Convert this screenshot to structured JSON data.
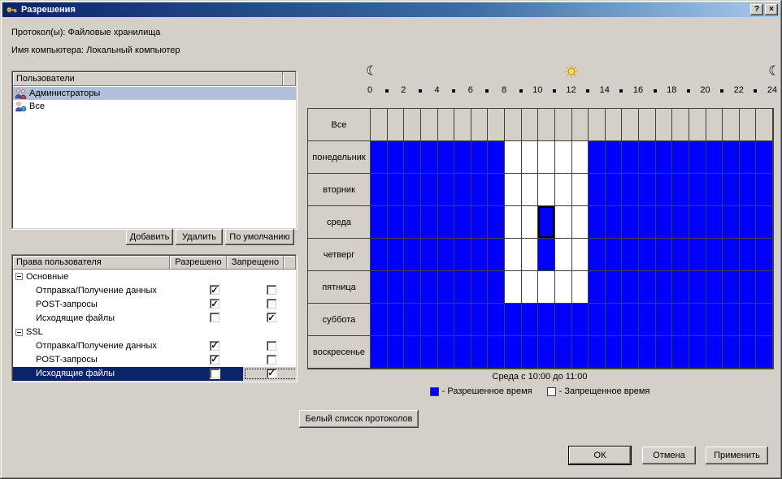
{
  "window": {
    "title": "Разрешения",
    "help_button": "?",
    "close_button": "×"
  },
  "header": {
    "protocols_label": "Протокол(ы): Файловые хранилища",
    "computer_label": "Имя компьютера: Локальный компьютер"
  },
  "users": {
    "header": "Пользователи",
    "items": [
      {
        "name": "Администраторы",
        "icon": "users-group-icon",
        "selected": true
      },
      {
        "name": "Все",
        "icon": "user-globe-icon",
        "selected": false
      }
    ],
    "buttons": {
      "add": "Добавить",
      "remove": "Удалить",
      "default": "По умолчанию"
    }
  },
  "rights": {
    "columns": [
      "Права пользователя",
      "Разрешено",
      "Запрещено"
    ],
    "rows": [
      {
        "type": "group",
        "label": "Основные"
      },
      {
        "type": "item",
        "label": "Отправка/Получение данных",
        "allowed": true,
        "denied": false
      },
      {
        "type": "item",
        "label": "POST-запросы",
        "allowed": true,
        "denied": false
      },
      {
        "type": "item",
        "label": "Исходящие файлы",
        "allowed": false,
        "denied": true
      },
      {
        "type": "group",
        "label": "SSL"
      },
      {
        "type": "item",
        "label": "Отправка/Получение данных",
        "allowed": true,
        "denied": false
      },
      {
        "type": "item",
        "label": "POST-запросы",
        "allowed": true,
        "denied": false
      },
      {
        "type": "item",
        "label": "Исходящие файлы",
        "allowed": false,
        "denied": true,
        "selected": true
      }
    ]
  },
  "whitelist_button": "Белый список протоколов",
  "schedule": {
    "hour_labels": [
      "0",
      "2",
      "4",
      "6",
      "8",
      "10",
      "12",
      "14",
      "16",
      "18",
      "20",
      "22",
      "24"
    ],
    "icons": {
      "left": "moon-icon",
      "middle": "sun-icon",
      "right": "moon-icon"
    },
    "rows": [
      {
        "label": "Все",
        "type": "all"
      },
      {
        "label": "понедельник",
        "type": "day",
        "cells": [
          1,
          1,
          1,
          1,
          1,
          1,
          1,
          1,
          0,
          0,
          0,
          0,
          0,
          1,
          1,
          1,
          1,
          1,
          1,
          1,
          1,
          1,
          1,
          1
        ]
      },
      {
        "label": "вторник",
        "type": "day",
        "cells": [
          1,
          1,
          1,
          1,
          1,
          1,
          1,
          1,
          0,
          0,
          0,
          0,
          0,
          1,
          1,
          1,
          1,
          1,
          1,
          1,
          1,
          1,
          1,
          1
        ]
      },
      {
        "label": "среда",
        "type": "day",
        "cells": [
          1,
          1,
          1,
          1,
          1,
          1,
          1,
          1,
          0,
          0,
          1,
          0,
          0,
          1,
          1,
          1,
          1,
          1,
          1,
          1,
          1,
          1,
          1,
          1
        ]
      },
      {
        "label": "четверг",
        "type": "day",
        "cells": [
          1,
          1,
          1,
          1,
          1,
          1,
          1,
          1,
          0,
          0,
          1,
          0,
          0,
          1,
          1,
          1,
          1,
          1,
          1,
          1,
          1,
          1,
          1,
          1
        ]
      },
      {
        "label": "пятница",
        "type": "day",
        "cells": [
          1,
          1,
          1,
          1,
          1,
          1,
          1,
          1,
          0,
          0,
          0,
          0,
          0,
          1,
          1,
          1,
          1,
          1,
          1,
          1,
          1,
          1,
          1,
          1
        ]
      },
      {
        "label": "суббота",
        "type": "day",
        "cells": [
          1,
          1,
          1,
          1,
          1,
          1,
          1,
          1,
          1,
          1,
          1,
          1,
          1,
          1,
          1,
          1,
          1,
          1,
          1,
          1,
          1,
          1,
          1,
          1
        ]
      },
      {
        "label": "воскресенье",
        "type": "day",
        "cells": [
          1,
          1,
          1,
          1,
          1,
          1,
          1,
          1,
          1,
          1,
          1,
          1,
          1,
          1,
          1,
          1,
          1,
          1,
          1,
          1,
          1,
          1,
          1,
          1
        ]
      }
    ],
    "selected_cell": {
      "row": "среда",
      "hour": 10
    },
    "selection_text": "Среда с 10:00 до 11:00",
    "legend": [
      {
        "color": "#0000ff",
        "label": "- Разрешенное время"
      },
      {
        "color": "#ffffff",
        "label": "- Запрещенное время"
      }
    ],
    "colors": {
      "allowed": "#0000ff",
      "denied": "#ffffff",
      "selection_border": "#000000"
    }
  },
  "footer": {
    "ok": "ОК",
    "cancel": "Отмена",
    "apply": "Применить"
  }
}
